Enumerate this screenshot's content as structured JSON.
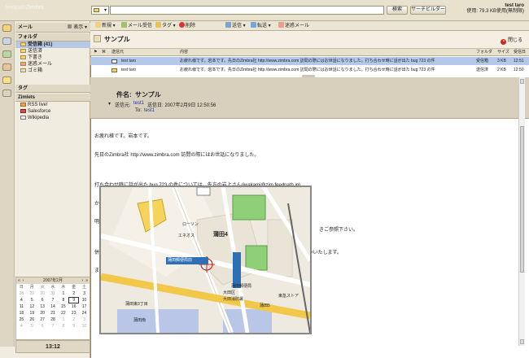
{
  "app": {
    "logo_a": "feedpath",
    "logo_b": "Zimbra"
  },
  "topbar": {
    "search_button": "検索",
    "search_builder_button": "サーチビルダー",
    "user_name": "test taro",
    "quota": "使用: 79.3 KB使用(無制限)"
  },
  "sidebar": {
    "header": "メール",
    "view_label": "表示",
    "folders_header": "フォルダ",
    "folders": [
      {
        "label": "受信箱 (41)"
      },
      {
        "label": "送信済"
      },
      {
        "label": "下書き"
      },
      {
        "label": "迷惑メール"
      },
      {
        "label": "ゴミ箱"
      }
    ],
    "tags_header": "タグ",
    "zimlets_header": "Zimlets",
    "zimlets": [
      {
        "label": "RSS live!"
      },
      {
        "label": "Salesforce"
      },
      {
        "label": "Wikipedia"
      }
    ],
    "clock": "13:12"
  },
  "calendar": {
    "month_label": "2007年2月",
    "weekdays": [
      "日",
      "月",
      "火",
      "水",
      "木",
      "金",
      "土"
    ],
    "days": [
      "28",
      "29",
      "30",
      "31",
      "1",
      "2",
      "3",
      "4",
      "5",
      "6",
      "7",
      "8",
      "9",
      "10",
      "11",
      "12",
      "13",
      "14",
      "15",
      "16",
      "17",
      "18",
      "19",
      "20",
      "21",
      "22",
      "23",
      "24",
      "25",
      "26",
      "27",
      "28",
      "1",
      "2",
      "3",
      "4",
      "5",
      "6",
      "7",
      "8",
      "9",
      "10"
    ]
  },
  "toolbar": {
    "new": "新規",
    "get_mail": "メール受信",
    "tag": "タグ",
    "delete": "削除",
    "reply": "送信",
    "forward": "転送",
    "spam": "迷惑メール",
    "close": "閉じる"
  },
  "conversation": {
    "subject": "サンプル"
  },
  "list": {
    "headers": {
      "from": "送信元",
      "content": "内容",
      "folder": "フォルダ",
      "size": "サイズ",
      "received": "受信日"
    },
    "rows": [
      {
        "from": "test taro",
        "content": "お疲れ様です。岩本です。先日のZimbra社 http://www.zimbra.com 訪問の際にはお世話になりました。打ち合わせ時に話が出た bug 723 の件",
        "folder": "受信箱",
        "size": "3 KB",
        "time": "12:51"
      },
      {
        "from": "test taro",
        "content": "お疲れ様です。岩本です。先日のZimbra社 http://www.zimbra.com 訪問の際にはお世話になりました。打ち合わせ時に話が出た bug 723 の件",
        "folder": "送信済",
        "size": "2 KB",
        "time": "12:50"
      }
    ]
  },
  "message": {
    "subject_label": "件名:",
    "subject": "サンプル",
    "from_label": "送信元:",
    "from": "test1",
    "date": "送信日: 2007年2月9日 12:50:56",
    "to_label": "To:",
    "to": "test1",
    "lines": [
      "お疲れ様です。岩本です。",
      "先日のZimbra社 http://www.zimbra.com 訪問の際にはお世話になりました。",
      "",
      "打ち合わせ時に話が出た bug 723 の件については、先方の岩上さん(iwakami@zim.feedpath.jp)",
      "から打ち合わせの要望がありました。",
      "明日、来週の金曜日、1月18日のうち、ご都合の良い日程のご予定をお知らせください。",
      "",
      "併せて手続きを進めております Zimbra用テストサーバの購入のご承認( GR733454-8788Q )をお願いいたします。",
      "また、弊社オフィスの場所は東京都文京区後楽1-14-1後楽森ビル12Fになります。"
    ],
    "trailing_text": "きご参照下さい。"
  },
  "map": {
    "labels": [
      "蒲田4",
      "ローソン",
      "エネオス",
      "蒲田郵便局前",
      "蒲田郵便局",
      "東急ストア",
      "大田区",
      "大田消防署",
      "蒲田東3丁目",
      "蒲田5",
      "蒲田南"
    ]
  }
}
